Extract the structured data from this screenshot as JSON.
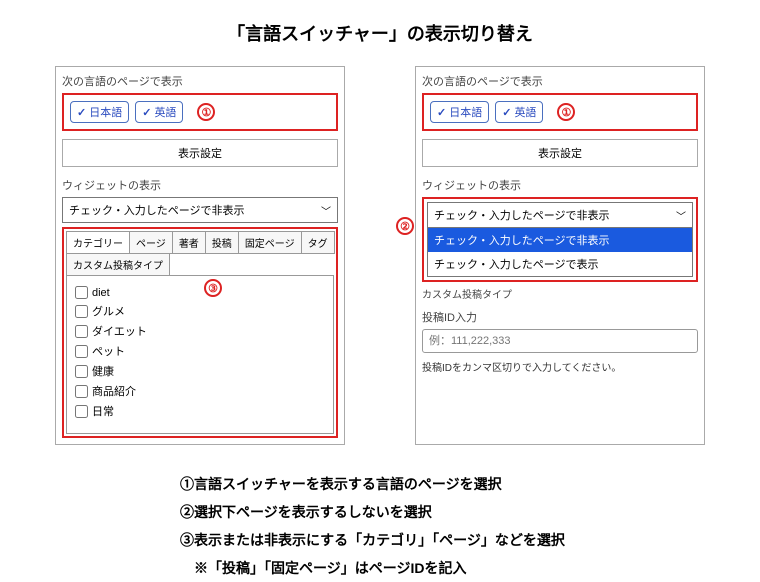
{
  "title": "「言語スイッチャー」の表示切り替え",
  "leftPanel": {
    "langSectionLabel": "次の言語のページで表示",
    "langs": [
      "日本語",
      "英語"
    ],
    "marker1": "①",
    "displaySettingsBtn": "表示設定",
    "widgetLabel": "ウィジェットの表示",
    "selectValue": "チェック・入力したページで非表示",
    "tabs": [
      "カテゴリー",
      "ページ",
      "著者",
      "投稿",
      "固定ページ",
      "タグ"
    ],
    "tabs2": [
      "カスタム投稿タイプ"
    ],
    "categories": [
      "diet",
      "グルメ",
      "ダイエット",
      "ペット",
      "健康",
      "商品紹介",
      "日常"
    ],
    "marker3": "③"
  },
  "rightPanel": {
    "langSectionLabel": "次の言語のページで表示",
    "langs": [
      "日本語",
      "英語"
    ],
    "marker1": "①",
    "displaySettingsBtn": "表示設定",
    "widgetLabel": "ウィジェットの表示",
    "selectValue": "チェック・入力したページで非表示",
    "dropdownOptions": [
      "チェック・入力したページで非表示",
      "チェック・入力したページで表示"
    ],
    "marker2": "②",
    "customLabel": "カスタム投稿タイプ",
    "idLabel": "投稿ID入力",
    "idPlaceholder": "例：111,222,333",
    "idHelp": "投稿IDをカンマ区切りで入力してください。"
  },
  "legend": {
    "line1": "①言語スイッチャーを表示する言語のページを選択",
    "line2": "②選択下ページを表示するしないを選択",
    "line3": "③表示または非表示にする「カテゴリ」「ページ」などを選択",
    "line4": "　※「投稿」「固定ページ」はページIDを記入"
  }
}
